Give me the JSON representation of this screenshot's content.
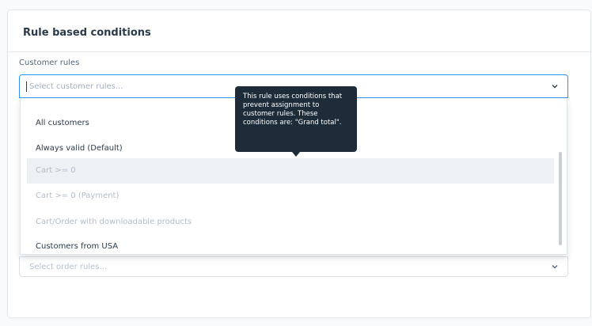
{
  "card": {
    "title": "Rule based conditions"
  },
  "customer_rules": {
    "label": "Customer rules",
    "placeholder": "Select customer rules...",
    "options": [
      {
        "label": "All customers",
        "disabled": false
      },
      {
        "label": "Always valid (Default)",
        "disabled": false
      },
      {
        "label": "Cart >= 0",
        "disabled": true
      },
      {
        "label": "Cart >= 0 (Payment)",
        "disabled": true
      },
      {
        "label": "Cart/Order with downloadable products",
        "disabled": true
      },
      {
        "label": "Customers from USA",
        "disabled": false
      }
    ]
  },
  "order_rules": {
    "placeholder": "Select order rules..."
  },
  "tooltip": {
    "text": "This rule uses conditions that prevent assignment to customer rules. These conditions are: \"Grand total\"."
  },
  "icons": {
    "chevron": "chevron-down-icon"
  },
  "colors": {
    "focus_border": "#2f94ec",
    "tooltip_bg": "#1e2c3a",
    "hover_bg": "#eef1f4"
  }
}
